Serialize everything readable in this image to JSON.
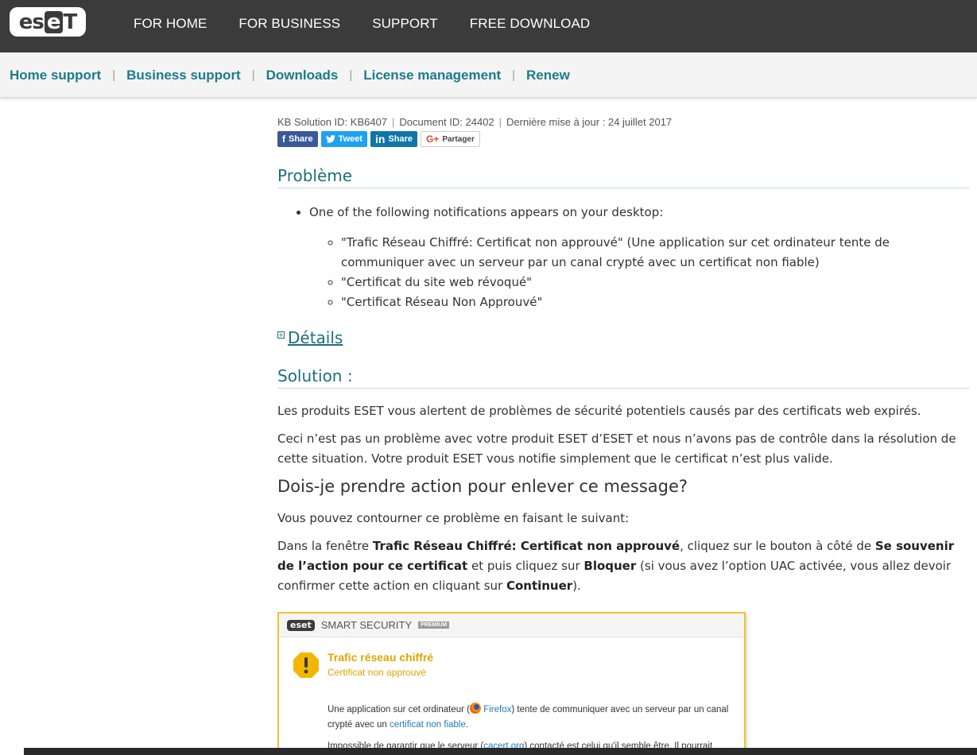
{
  "brand": {
    "logo_part1": "es",
    "logo_part2": "e",
    "logo_part3": "T"
  },
  "topnav": {
    "items": [
      "FOR HOME",
      "FOR BUSINESS",
      "SUPPORT",
      "FREE DOWNLOAD"
    ]
  },
  "subnav": {
    "items": [
      "Home support",
      "Business support",
      "Downloads",
      "License management",
      "Renew"
    ],
    "separator": "|"
  },
  "meta": {
    "kb_id": "KB Solution ID: KB6407",
    "doc_id": "Document ID: 24402",
    "updated": "Dernière mise à jour : 24 juillet 2017",
    "separator": "|"
  },
  "share": {
    "facebook": "Share",
    "twitter": "Tweet",
    "linkedin": "Share",
    "google": "Partager"
  },
  "probleme": {
    "heading": "Problème",
    "bullet": "One of the following notifications appears on your desktop:",
    "sub_items": [
      "\"Trafic Réseau Chiffré: Certificat non approuvé\" (Une application sur cet ordinateur tente de communiquer avec un serveur par un canal crypté avec un certificat non fiable)",
      "\"Certificat du site web révoqué\"",
      "\"Certificat Réseau Non Approuvé\""
    ]
  },
  "details": {
    "label": "Détails",
    "toggle": "+"
  },
  "solution": {
    "heading": "Solution :",
    "p1": "Les produits ESET vous alertent  de problèmes de sécurité potentiels causés par des certificats web expirés.",
    "p2": "Ceci n’est pas un problème avec votre produit ESET d’ESET et nous n’avons pas de contrôle dans la résolution de cette situation. Votre produit ESET vous notifie simplement que le certificat n’est plus valide.",
    "question": "Dois-je prendre action pour enlever ce message?",
    "p3": "Vous pouvez contourner ce problème en faisant le suivant:",
    "p4_a": "Dans la fenêtre ",
    "p4_b": "Trafic Réseau Chiffré: Certificat non approuvé",
    "p4_c": ", cliquez sur le bouton à côté de ",
    "p4_d": "Se souvenir de l’action pour ce certificat",
    "p4_e": " et puis cliquez sur ",
    "p4_f": "Bloquer",
    "p4_g": " (si vous avez l’option UAC activée, vous allez devoir confirmer cette action en cliquant sur ",
    "p4_h": "Continuer",
    "p4_i": ")."
  },
  "screenshot": {
    "logo": "eset",
    "product": "SMART SECURITY",
    "badge": "PREMIUM",
    "alert_title": "Trafic réseau chiffré",
    "alert_subtitle": "Certificat non approuvé",
    "text_a": "Une application sur cet ordinateur (",
    "app_link": "Firefox",
    "text_b": ") tente de communiquer avec un serveur par un canal crypté avec un ",
    "cert_link": "certificat non fiable",
    "text_c": ".",
    "text2_a": "Impossible de garantir que le serveur (",
    "server_link": "cacert.org",
    "text2_b": ") contacté est celui qu'il semble être. Il pourrait"
  },
  "colors": {
    "topbar": "#3b3b3b",
    "link_teal": "#1b7b8c",
    "warning": "#e0a500",
    "frame": "#f1c232"
  }
}
